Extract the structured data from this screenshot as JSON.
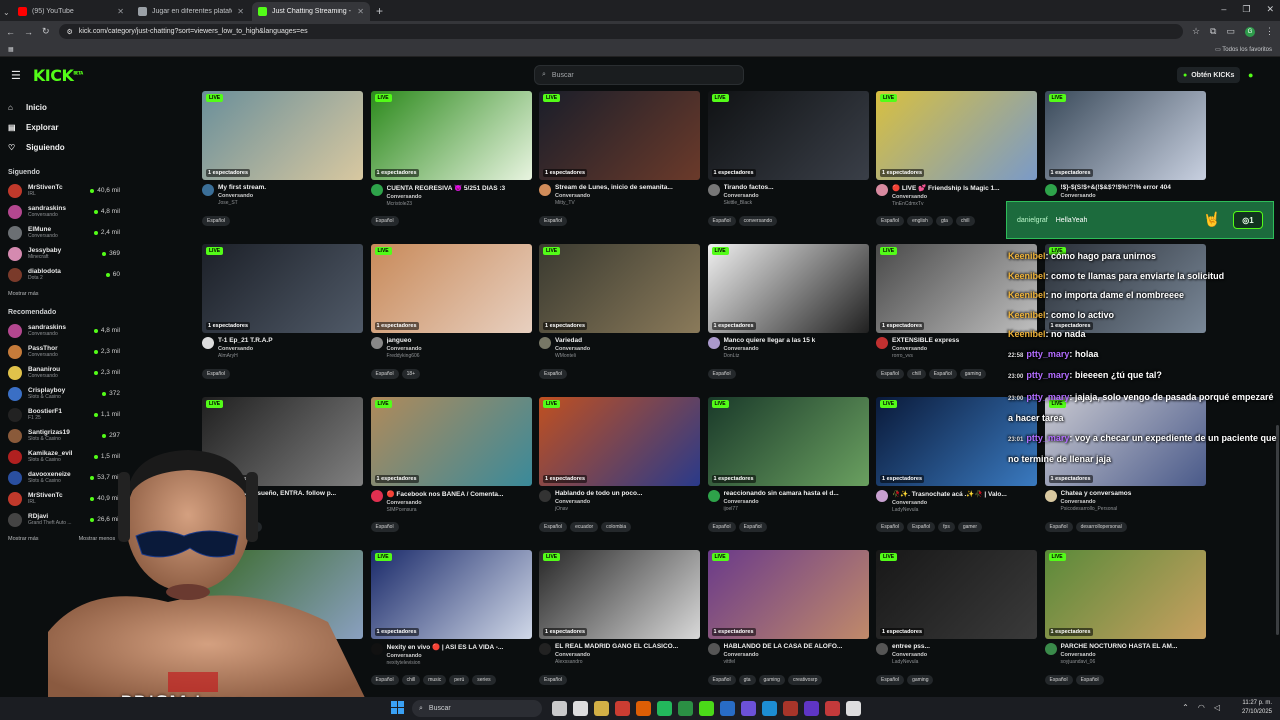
{
  "browser": {
    "tabs": [
      {
        "title": "(95) YouTube",
        "color": "#ff0000",
        "active": false
      },
      {
        "title": "Jugar en diferentes plataformas",
        "color": "#9aa0a6",
        "active": false
      },
      {
        "title": "Just Chatting Streaming - Live",
        "color": "#53fc18",
        "active": true
      }
    ],
    "url": "kick.com/category/just-chatting?sort=viewers_low_to_high&languages=es",
    "favorites": "Todos los favoritos"
  },
  "header": {
    "logo": "KICK",
    "logo_sup": "BETA",
    "search_placeholder": "Buscar",
    "get_kicks": "Obtén KICKs",
    "brand_color": "#53fc18"
  },
  "sidebar": {
    "nav": [
      {
        "label": "Inicio",
        "icon": "home-icon"
      },
      {
        "label": "Explorar",
        "icon": "compass-icon"
      },
      {
        "label": "Siguiendo",
        "icon": "heart-icon"
      }
    ],
    "following_title": "Siguendo",
    "following": [
      {
        "name": "MrStivenTc",
        "cat": "IRL",
        "viewers": "40,6 mil",
        "color": "#c0392b"
      },
      {
        "name": "sandraskins",
        "cat": "Conversando",
        "viewers": "4,8 mil",
        "color": "#b3478f"
      },
      {
        "name": "ElMune",
        "cat": "Conversando",
        "viewers": "2,4 mil",
        "color": "#6b6f73"
      },
      {
        "name": "Jessybaby",
        "cat": "Minecraft",
        "viewers": "369",
        "color": "#d58ab0"
      },
      {
        "name": "diablodota",
        "cat": "Dota 2",
        "viewers": "60",
        "color": "#7a3a2a"
      }
    ],
    "show_more": "Mostrar más",
    "recommended_title": "Recomendado",
    "recommended": [
      {
        "name": "sandraskins",
        "cat": "Conversando",
        "viewers": "4,8 mil",
        "color": "#b3478f"
      },
      {
        "name": "PassThor",
        "cat": "Conversando",
        "viewers": "2,3 mil",
        "color": "#c57b3a"
      },
      {
        "name": "Bananirou",
        "cat": "Conversando",
        "viewers": "2,3 mil",
        "color": "#e0c24a"
      },
      {
        "name": "Crisplayboy",
        "cat": "Slots & Casino",
        "viewers": "372",
        "color": "#3a6fc5"
      },
      {
        "name": "BoostierF1",
        "cat": "F1 25",
        "viewers": "1,1 mil",
        "color": "#222"
      },
      {
        "name": "Santigrizas19",
        "cat": "Slots & Casino",
        "viewers": "297",
        "color": "#8a5a3a"
      },
      {
        "name": "Kamikaze_evil",
        "cat": "Slots & Casino",
        "viewers": "1,5 mil",
        "color": "#b02020"
      },
      {
        "name": "davooxeneize",
        "cat": "Slots & Casino",
        "viewers": "53,7 mil",
        "color": "#2a4fa0"
      },
      {
        "name": "MrStivenTc",
        "cat": "IRL",
        "viewers": "40,9 mil",
        "color": "#c0392b"
      },
      {
        "name": "RDjavi",
        "cat": "Grand Theft Auto ...",
        "viewers": "26,6 mil",
        "color": "#444"
      }
    ],
    "show_more_2": "Mostrar más",
    "show_less": "Mostrar menos"
  },
  "cards": [
    {
      "title": "My first stream.",
      "cat": "Conversando",
      "user": "Jose_ST",
      "tags": [
        "Español"
      ],
      "viewers": "1 espectadores",
      "bg": [
        "#6a8f9a",
        "#d8c8a0"
      ],
      "av": "#3b6f98"
    },
    {
      "title": "CUENTA REGRESIVA 😈 5/251 DIAS :3",
      "cat": "Conversando",
      "user": "Mcristole23",
      "tags": [
        "Español"
      ],
      "viewers": "1 espectadores",
      "bg": [
        "#2c8a1c",
        "#e8f4e0"
      ],
      "av": "#2ea34a"
    },
    {
      "title": "Stream de Lunes, inicio de semanita...",
      "cat": "Conversando",
      "user": "Mitty_TV",
      "tags": [
        "Español"
      ],
      "viewers": "1 espectadores",
      "bg": [
        "#1a1e2a",
        "#6b3a2a"
      ],
      "av": "#d08c5a"
    },
    {
      "title": "Tirando factos...",
      "cat": "Conversando",
      "user": "Skittle_Black",
      "tags": [
        "Español",
        "conversando"
      ],
      "viewers": "1 espectadores",
      "bg": [
        "#101214",
        "#3a3f48"
      ],
      "av": "#777"
    },
    {
      "title": "🔴 LIVE 💕 Friendship Is Magic 1...",
      "cat": "Conversando",
      "user": "TinEnCdmxTv",
      "tags": [
        "Español",
        "english",
        "gta",
        "chill"
      ],
      "viewers": "1 espectadores",
      "bg": [
        "#d8c040",
        "#7a9ac8"
      ],
      "av": "#d88aa0"
    },
    {
      "title": "!$}-$(S!$+&(!$&$?!$%!?!% error 404",
      "cat": "Conversando",
      "user": "",
      "tags": [],
      "viewers": "1 espectadores",
      "bg": [
        "#3a4a5a",
        "#c8d0e0"
      ],
      "av": "#2ea34a"
    },
    {
      "title": "T-1 Ep_21 T.R.A.P",
      "cat": "Conversando",
      "user": "AlmAryH",
      "tags": [
        "Español"
      ],
      "viewers": "1 espectadores",
      "bg": [
        "#1c2028",
        "#505a68"
      ],
      "av": "#ddd"
    },
    {
      "title": "jangueo",
      "cat": "Conversando",
      "user": "Freddyking606",
      "tags": [
        "Español",
        "18+"
      ],
      "viewers": "1 espectadores",
      "bg": [
        "#c88a5a",
        "#e8d0c0"
      ],
      "av": "#888"
    },
    {
      "title": "Variedad",
      "cat": "Conversando",
      "user": "WMonteli",
      "tags": [
        "Español"
      ],
      "viewers": "1 espectadores",
      "bg": [
        "#3a3a30",
        "#8a7a5a"
      ],
      "av": "#776"
    },
    {
      "title": "Manco quiere llegar a las 15 k",
      "cat": "Conversando",
      "user": "DonLtz",
      "tags": [
        "Español"
      ],
      "viewers": "1 espectadores",
      "bg": [
        "#f0f0f0",
        "#202020"
      ],
      "av": "#a9c"
    },
    {
      "title": "EXTENSIBLE express",
      "cat": "Conversando",
      "user": "rorro_vvs",
      "tags": [
        "Español",
        "chill",
        "Español",
        "gaming"
      ],
      "viewers": "1 espectadores",
      "bg": [
        "#4a4a4a",
        "#c0c0c0"
      ],
      "av": "#c03030"
    },
    {
      "title": "",
      "cat": "",
      "user": "",
      "tags": [],
      "viewers": "1 espectadores",
      "bg": [
        "#2a3038",
        "#7a8898"
      ],
      "av": "#555"
    },
    {
      "title": "...i no tienes sueño, ENTRA. follow p...",
      "cat": "Conversando",
      "user": "sscafogcam",
      "tags": [
        "Español",
        "kickperu"
      ],
      "viewers": "1 espectadores",
      "bg": [
        "#202020",
        "#808080"
      ],
      "av": "#444"
    },
    {
      "title": "🔴 Facebook nos BANEA / Comenta...",
      "cat": "Conversando",
      "user": "SIMPcensura",
      "tags": [
        "Español"
      ],
      "viewers": "1 espectadores",
      "bg": [
        "#b08a5a",
        "#3a8a9a"
      ],
      "av": "#e03050"
    },
    {
      "title": "Hablando de todo un poco...",
      "cat": "Conversando",
      "user": "jOnav",
      "tags": [
        "Español",
        "ecuador",
        "colombia"
      ],
      "viewers": "1 espectadores",
      "bg": [
        "#c05020",
        "#2a3a8a"
      ],
      "av": "#333"
    },
    {
      "title": "reaccionando sin camara hasta el d...",
      "cat": "Conversando",
      "user": "ijoel77",
      "tags": [
        "Español",
        "Español"
      ],
      "viewers": "1 espectadores",
      "bg": [
        "#1a3a2a",
        "#6aa060"
      ],
      "av": "#2ea34a"
    },
    {
      "title": "🥀✨. Trasnochate acá .✨🥀 | Valo...",
      "cat": "Conversando",
      "user": "LadyNevula",
      "tags": [
        "Español",
        "Español",
        "fps",
        "gamer"
      ],
      "viewers": "1 espectadores",
      "bg": [
        "#0a1a3a",
        "#3a7ac0"
      ],
      "av": "#c8a0d0"
    },
    {
      "title": "Chatea y conversamos",
      "cat": "Conversando",
      "user": "Psicodesarrollo_Personal",
      "tags": [
        "Español",
        "desarrollopersonal"
      ],
      "viewers": "1 espectadores",
      "bg": [
        "#c8c8d0",
        "#4a5a8a"
      ],
      "av": "#d8c8a0"
    },
    {
      "title": "",
      "cat": "",
      "user": "",
      "tags": [],
      "viewers": "",
      "bg": [
        "#3a6a2a",
        "#8aa0c0"
      ],
      "av": "#555"
    },
    {
      "title": "Nexity en vivo 🔴 | ASI ES LA VIDA -...",
      "cat": "Conversando",
      "user": "nexitytelevision",
      "tags": [
        "Español",
        "chill",
        "music",
        "perú",
        "series"
      ],
      "viewers": "1 espectadores",
      "bg": [
        "#1a2a6a",
        "#d0d8e8"
      ],
      "av": "#111"
    },
    {
      "title": "EL REAL MADRID GANO EL CLASICO...",
      "cat": "Conversando",
      "user": "Alexssandro",
      "tags": [
        "Español"
      ],
      "viewers": "1 espectadores",
      "bg": [
        "#282828",
        "#d8d8d8"
      ],
      "av": "#222"
    },
    {
      "title": "HABLANDO DE LA CASA DE ALOFO...",
      "cat": "Conversando",
      "user": "vittfel",
      "tags": [
        "Español",
        "gta",
        "gaming",
        "creativosrp"
      ],
      "viewers": "1 espectadores",
      "bg": [
        "#6a3a8a",
        "#c08a6a"
      ],
      "av": "#555"
    },
    {
      "title": "entree pss...",
      "cat": "Conversando",
      "user": "LadyNevula",
      "tags": [
        "Español",
        "gaming"
      ],
      "viewers": "1 espectadores",
      "bg": [
        "#181818",
        "#3a3a3a"
      ],
      "av": "#555"
    },
    {
      "title": "PARCHE NOCTURNO HASTA EL AM...",
      "cat": "Conversando",
      "user": "soyjuandavi_06",
      "tags": [
        "Español",
        "Español"
      ],
      "viewers": "1 espectadores",
      "bg": [
        "#5a8a3a",
        "#c8a060"
      ],
      "av": "#3a8a4a"
    }
  ],
  "overlay": {
    "lens_text": "PRISM Lens",
    "highlight_user": "danielgraf",
    "highlight_text": "HellaYeah",
    "highlight_badge": "1",
    "chat": [
      {
        "time": "",
        "user": "Keenibel",
        "text": "cómo hago para unirnos",
        "color": "u1"
      },
      {
        "time": "",
        "user": "Keenibel",
        "text": "como te llamas para enviarte la solicitud",
        "color": "u1"
      },
      {
        "time": "",
        "user": "Keenibel",
        "text": "no importa dame el nombreeee",
        "color": "u1"
      },
      {
        "time": "",
        "user": "Keenibel",
        "text": "como lo activo",
        "color": "u1"
      },
      {
        "time": "",
        "user": "Keenibel",
        "text": "no nada",
        "color": "u1"
      },
      {
        "time": "22:58",
        "user": "ptty_mary",
        "text": "holaa",
        "color": "u2"
      },
      {
        "time": "23:00",
        "user": "ptty_mary",
        "text": "bieeeen ¿tú que tal?",
        "color": "u2"
      },
      {
        "time": "23:00",
        "user": "ptty_mary",
        "text": "jajaja, solo vengo de pasada porqué empezaré a hacer tarea",
        "color": "u2"
      },
      {
        "time": "23:01",
        "user": "ptty_mary",
        "text": "voy a checar un expediente de un paciente que no termine de llenar jaja",
        "color": "u2"
      }
    ]
  },
  "taskbar": {
    "search": "Buscar",
    "time": "11:27 p. m.",
    "date": "27/10/2025"
  }
}
